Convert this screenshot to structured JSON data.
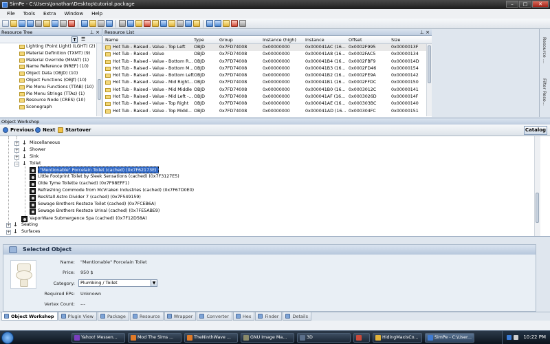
{
  "window": {
    "title": "SimPe - C:\\Users\\Jonathan\\Desktop\\tutorial.package",
    "buttons": {
      "minimize": "–",
      "maximize": "□",
      "close": "✕"
    }
  },
  "menubar": [
    "File",
    "Tools",
    "Extra",
    "Window",
    "Help"
  ],
  "resource_tree": {
    "header": "Resource Tree",
    "pin": "⊥ ×",
    "filter_label": "T",
    "items": [
      "Lighting (Point Light) (LGHT) (2)",
      "Material Definition (TXMT) (9)",
      "Material Override (MMAT) (1)",
      "Name Reference (NREF) (10)",
      "Object Data (OBJD) (10)",
      "Object Functions (OBJf) (10)",
      "Pie Menu Functions (TTAB) (10)",
      "Pie Menu Strings (TTAs) (1)",
      "Resource Node (CRES) (10)",
      "Scenegraph"
    ]
  },
  "resource_list": {
    "header": "Resource List",
    "pin": "⊥ ×",
    "columns": [
      "Name",
      "Type",
      "Group",
      "Instance (high)",
      "Instance",
      "Offset",
      "Size"
    ],
    "rows": [
      [
        "Hot Tub - Raised - Value - Top Left",
        "OBJD",
        "0x7FD74008",
        "0x00000000",
        "0x000041AC (16...",
        "0x0002F995",
        "0x0000013F"
      ],
      [
        "Hot Tub - Raised - Value",
        "OBJD",
        "0x7FD74008",
        "0x00000000",
        "0x000041A8 (16...",
        "0x0002FAC5",
        "0x00000134"
      ],
      [
        "Hot Tub - Raised - Value - Bottom R...",
        "OBJD",
        "0x7FD74008",
        "0x00000000",
        "0x000041B4 (16...",
        "0x0002FBF9",
        "0x0000014D"
      ],
      [
        "Hot Tub - Raised - Value - Bottom M...",
        "OBJD",
        "0x7FD74008",
        "0x00000000",
        "0x000041B3 (16...",
        "0x0002FD46",
        "0x00000154"
      ],
      [
        "Hot Tub - Raised - Value - Bottom Left",
        "OBJD",
        "0x7FD74008",
        "0x00000000",
        "0x000041B2 (16...",
        "0x0002FE9A",
        "0x00000142"
      ],
      [
        "Hot Tub - Raised - Value - Mid Right...",
        "OBJD",
        "0x7FD74008",
        "0x00000000",
        "0x000041B1 (16...",
        "0x0002FFDC",
        "0x00000150"
      ],
      [
        "Hot Tub - Raised - Value - Mid Middle",
        "OBJD",
        "0x7FD74008",
        "0x00000000",
        "0x000041B0 (16...",
        "0x0003012C",
        "0x00000141"
      ],
      [
        "Hot Tub - Raised - Value - Mid Left -...",
        "OBJD",
        "0x7FD74008",
        "0x00000000",
        "0x000041AF (16...",
        "0x0003026D",
        "0x0000014F"
      ],
      [
        "Hot Tub - Raised - Value - Top Right",
        "OBJD",
        "0x7FD74008",
        "0x00000000",
        "0x000041AE (16...",
        "0x000303BC",
        "0x00000140"
      ],
      [
        "Hot Tub - Raised - Value - Top Midd...",
        "OBJD",
        "0x7FD74008",
        "0x00000000",
        "0x000041AD (16...",
        "0x000304FC",
        "0x00000151"
      ]
    ]
  },
  "right_tabs": [
    "Resource ...",
    "Filter Reso..."
  ],
  "object_workshop": {
    "header": "Object Workshop",
    "nav": {
      "previous": "Previous",
      "next": "Next",
      "startover": "Startover",
      "catalog": "Catalog"
    },
    "tree": {
      "categories_above": [
        "Miscellaneous",
        "Shower",
        "Sink"
      ],
      "expanded_category": "Toilet",
      "items": [
        "\"Mentionable\" Porcelain Toilet (cached) (0x7F62173E)",
        "Little Footprint Toilet by Sleek Sensations (cached) (0x7F3127E5)",
        "Olde Tyme Toilette (cached) (0x7F98EFF1)",
        "Refreshing Commode from McVraken Industries (cached) (0x7F67D0E0)",
        "ResStall Astro Divider 7 (cached) (0x7F549159)",
        "Sewage Brothers Resteze Toilet (cached) (0x7FCEB6A)",
        "Sewage Brothers Resteze Urinal (cached) (0x7FE5ABE9)"
      ],
      "after_item": "VaporWare Submergence Spa (cached) (0x7F12D58A)",
      "categories_below": [
        "Seating",
        "Surfaces"
      ]
    }
  },
  "selected_object": {
    "title": "Selected Object",
    "fields": {
      "name_label": "Name:",
      "name_value": "\"Mentionable\" Porcelain Toilet",
      "price_label": "Price:",
      "price_value": "950 $",
      "category_label": "Category:",
      "category_value": "Plumbing / Toilet",
      "eps_label": "Required EPs:",
      "eps_value": "Unknown",
      "vertex_label": "Vertex Count:",
      "vertex_value": "---"
    }
  },
  "bottom_tabs": [
    "Object Workshop",
    "Plugin View",
    "Package",
    "Resource",
    "Wrapper",
    "Converter",
    "Hex",
    "Finder",
    "Details"
  ],
  "taskbar": {
    "buttons": [
      "Yahoo! Messen...",
      "Mod The Sims ...",
      "TheNinthWave ...",
      "GNU Image Ma...",
      "3D",
      "",
      "HidingMaxisCo...",
      "SimPe - C:\\User..."
    ],
    "clock": "10:22 PM"
  },
  "colors": {
    "selection": "#3169c6",
    "titlebar": "#1d1d1d",
    "panel": "#dfe6ee"
  }
}
